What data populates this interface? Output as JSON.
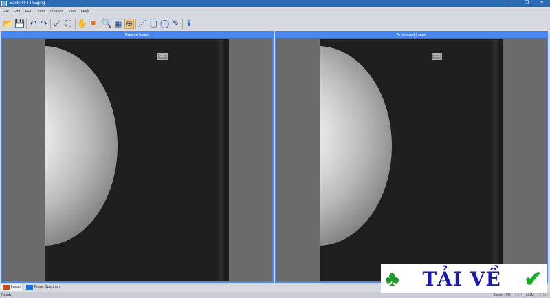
{
  "window": {
    "title": "Sante FFT Imaging",
    "minimize": "—",
    "maximize": "❐",
    "close": "✕"
  },
  "menu": [
    "File",
    "Edit",
    "FFT",
    "Tools",
    "Options",
    "View",
    "Help"
  ],
  "toolbar": [
    {
      "name": "open-icon",
      "glyph": "📂"
    },
    {
      "name": "save-icon",
      "glyph": "💾"
    },
    {
      "sep": true
    },
    {
      "name": "undo-icon",
      "glyph": "↶"
    },
    {
      "name": "redo-icon",
      "glyph": "↷"
    },
    {
      "sep": true
    },
    {
      "name": "fit-window-icon",
      "glyph": "⤢"
    },
    {
      "name": "full-screen-icon",
      "glyph": "⛶"
    },
    {
      "sep": true
    },
    {
      "name": "pan-hand-icon",
      "glyph": "✋"
    },
    {
      "name": "brightness-icon",
      "glyph": "✸"
    },
    {
      "sep": true
    },
    {
      "name": "zoom-icon",
      "glyph": "🔍"
    },
    {
      "name": "image-overview-icon",
      "glyph": "▦"
    },
    {
      "name": "magnify-icon",
      "glyph": "⊕",
      "active": true
    },
    {
      "sep": true
    },
    {
      "name": "brush-icon",
      "glyph": "／"
    },
    {
      "name": "rectangle-icon",
      "glyph": "▢"
    },
    {
      "name": "ellipse-icon",
      "glyph": "◯"
    },
    {
      "name": "freehand-icon",
      "glyph": "✎"
    },
    {
      "sep": true
    },
    {
      "name": "info-icon",
      "glyph": "ℹ"
    }
  ],
  "panels": {
    "original": {
      "title": "Original Image",
      "label": "CCI"
    },
    "processed": {
      "title": "Processed Image",
      "label": "CCI"
    }
  },
  "tabs": [
    {
      "label": "Image",
      "color": "#c0501a",
      "active": true
    },
    {
      "label": "Power Spectrum",
      "color": "#1b6fe0",
      "active": false
    }
  ],
  "status": {
    "text": "Ready",
    "zoom": "Zoom: 10%",
    "cap": "CAP",
    "num": "NUM",
    "scrl": "SCRL"
  },
  "watermark": {
    "text": "TẢI VỀ"
  }
}
